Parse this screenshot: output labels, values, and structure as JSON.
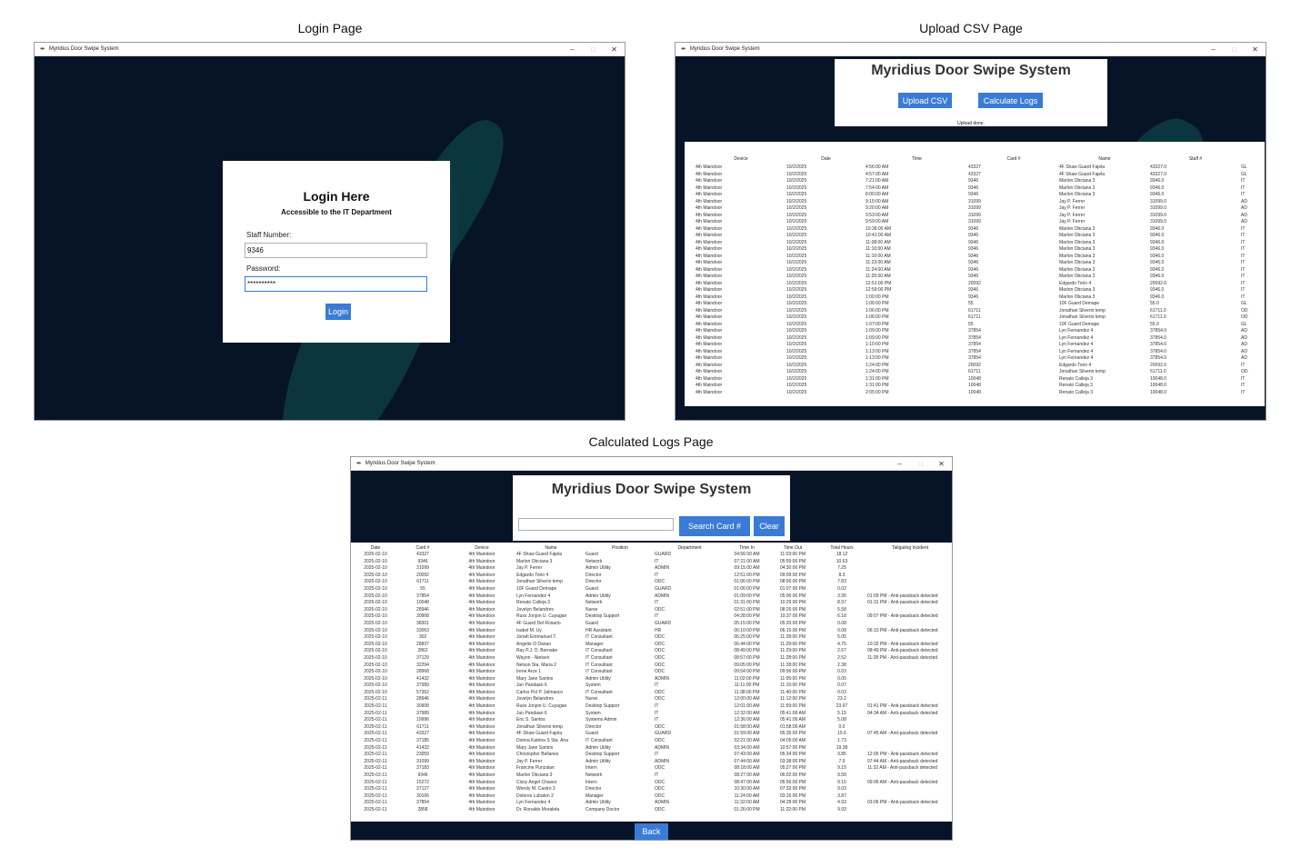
{
  "captions": {
    "login": "Login Page",
    "upload": "Upload CSV Page",
    "calc": "Calculated Logs Page"
  },
  "window": {
    "title": "Myridius Door Swipe System",
    "minimize": "–",
    "maximize": "□",
    "close": "✕"
  },
  "login": {
    "heading": "Login Here",
    "subheading": "Accessible to the IT Department",
    "staff_label": "Staff Number:",
    "staff_value": "9346",
    "password_label": "Password:",
    "password_value": "**********",
    "login_button": "Login"
  },
  "upload": {
    "heading": "Myridius Door Swipe System",
    "upload_button": "Upload CSV",
    "calculate_button": "Calculate Logs",
    "status": "Upload done.",
    "columns": [
      "Device",
      "Date",
      "Time",
      "Card #",
      "Name",
      "Staff #",
      ""
    ],
    "rows": [
      [
        "4th Maindoor",
        "10/2/2025",
        "4:56:00 AM",
        "43327",
        "4F Shaw Guard Fajela",
        "43327.0",
        "GL"
      ],
      [
        "4th Maindoor",
        "10/2/2025",
        "4:57:00 AM",
        "43327",
        "4F Shaw Guard Fajela",
        "43327.0",
        "GL"
      ],
      [
        "4th Maindoor",
        "10/2/2025",
        "7:21:00 AM",
        "9346",
        "Marlon Obciana 3",
        "9346.0",
        "IT"
      ],
      [
        "4th Maindoor",
        "10/2/2025",
        "7:54:00 AM",
        "9346",
        "Marlon Obciana 3",
        "9346.0",
        "IT"
      ],
      [
        "4th Maindoor",
        "10/2/2025",
        "8:00:00 AM",
        "9346",
        "Marlon Obciana 3",
        "9346.0",
        "IT"
      ],
      [
        "4th Maindoor",
        "10/2/2025",
        "9:15:00 AM",
        "31099",
        "Jay P. Ferrer",
        "31099.0",
        "AD"
      ],
      [
        "4th Maindoor",
        "10/2/2025",
        "9:20:00 AM",
        "31099",
        "Jay P. Ferrer",
        "31099.0",
        "AD"
      ],
      [
        "4th Maindoor",
        "10/2/2025",
        "9:53:00 AM",
        "31099",
        "Jay P. Ferrer",
        "31099.0",
        "AD"
      ],
      [
        "4th Maindoor",
        "10/2/2025",
        "9:59:00 AM",
        "31099",
        "Jay P. Ferrer",
        "31099.0",
        "AD"
      ],
      [
        "4th Maindoor",
        "10/2/2025",
        "10:36:00 AM",
        "9346",
        "Marlon Obciana 3",
        "9346.0",
        "IT"
      ],
      [
        "4th Maindoor",
        "10/2/2025",
        "10:41:00 AM",
        "9346",
        "Marlon Obciana 3",
        "9346.0",
        "IT"
      ],
      [
        "4th Maindoor",
        "10/2/2025",
        "11:08:00 AM",
        "9346",
        "Marlon Obciana 3",
        "9346.0",
        "IT"
      ],
      [
        "4th Maindoor",
        "10/2/2025",
        "11:10:00 AM",
        "9346",
        "Marlon Obciana 3",
        "9346.0",
        "IT"
      ],
      [
        "4th Maindoor",
        "10/2/2025",
        "11:10:00 AM",
        "9346",
        "Marlon Obciana 3",
        "9346.0",
        "IT"
      ],
      [
        "4th Maindoor",
        "10/2/2025",
        "11:23:00 AM",
        "9346",
        "Marlon Obciana 3",
        "9346.0",
        "IT"
      ],
      [
        "4th Maindoor",
        "10/2/2025",
        "11:24:00 AM",
        "9346",
        "Marlon Obciana 3",
        "9346.0",
        "IT"
      ],
      [
        "4th Maindoor",
        "10/2/2025",
        "11:25:00 AM",
        "9346",
        "Marlon Obciana 3",
        "9346.0",
        "IT"
      ],
      [
        "4th Maindoor",
        "10/2/2025",
        "12:51:00 PM",
        "20092",
        "Edgardo Torio 4",
        "20092.0",
        "IT"
      ],
      [
        "4th Maindoor",
        "10/2/2025",
        "12:59:00 PM",
        "9346",
        "Marlon Obciana 3",
        "9346.0",
        "IT"
      ],
      [
        "4th Maindoor",
        "10/2/2025",
        "1:00:00 PM",
        "9346",
        "Marlon Obciana 3",
        "9346.0",
        "IT"
      ],
      [
        "4th Maindoor",
        "10/2/2025",
        "1:06:00 PM",
        "55",
        "10F Guard Demape",
        "55.0",
        "GL"
      ],
      [
        "4th Maindoor",
        "10/2/2025",
        "1:06:00 PM",
        "61711",
        "Jonathan Silverio temp",
        "61711.0",
        "OD"
      ],
      [
        "4th Maindoor",
        "10/2/2025",
        "1:06:00 PM",
        "61711",
        "Jonathan Silverio temp",
        "61711.0",
        "OD"
      ],
      [
        "4th Maindoor",
        "10/2/2025",
        "1:07:00 PM",
        "55",
        "10F Guard Demape",
        "55.0",
        "GL"
      ],
      [
        "4th Maindoor",
        "10/2/2025",
        "1:09:00 PM",
        "37854",
        "Lyn Fernandez 4",
        "37854.0",
        "AD"
      ],
      [
        "4th Maindoor",
        "10/2/2025",
        "1:09:00 PM",
        "37854",
        "Lyn Fernandez 4",
        "37854.0",
        "AD"
      ],
      [
        "4th Maindoor",
        "10/2/2025",
        "1:10:00 PM",
        "37854",
        "Lyn Fernandez 4",
        "37854.0",
        "AD"
      ],
      [
        "4th Maindoor",
        "10/2/2025",
        "1:13:00 PM",
        "37854",
        "Lyn Fernandez 4",
        "37854.0",
        "AD"
      ],
      [
        "4th Maindoor",
        "10/2/2025",
        "1:13:00 PM",
        "37854",
        "Lyn Fernandez 4",
        "37854.0",
        "AD"
      ],
      [
        "4th Maindoor",
        "10/2/2025",
        "1:24:00 PM",
        "20092",
        "Edgardo Torio 4",
        "20092.0",
        "IT"
      ],
      [
        "4th Maindoor",
        "10/2/2025",
        "1:24:00 PM",
        "61711",
        "Jonathan Silverio temp",
        "61711.0",
        "OD"
      ],
      [
        "4th Maindoor",
        "10/2/2025",
        "1:31:00 PM",
        "10048",
        "Renato Calleja 3",
        "10048.0",
        "IT"
      ],
      [
        "4th Maindoor",
        "10/2/2025",
        "1:31:00 PM",
        "10048",
        "Renato Calleja 3",
        "10048.0",
        "IT"
      ],
      [
        "4th Maindoor",
        "10/2/2025",
        "2:05:00 PM",
        "10048",
        "Renato Calleja 3",
        "10048.0",
        "IT"
      ]
    ]
  },
  "calc": {
    "heading": "Myridius Door Swipe System",
    "search_value": "",
    "search_button": "Search Card #",
    "clear_button": "Clear",
    "back_button": "Back",
    "columns": [
      "Date",
      "Card #",
      "Device",
      "Name",
      "Position",
      "Department",
      "Time In",
      "Time Out",
      "Total Hours",
      "Tailgating Incident"
    ],
    "rows": [
      [
        "2025-02-10",
        "43327",
        "4th Maindoor",
        "4F Shaw Guard Fajela",
        "Guard",
        "GUARD",
        "04:56:00 AM",
        "11:03:00 PM",
        "18.12",
        ""
      ],
      [
        "2025-02-10",
        "9346",
        "4th Maindoor",
        "Marlon Obciana 3",
        "Network",
        "IT",
        "07:21:00 AM",
        "05:59:00 PM",
        "10.63",
        ""
      ],
      [
        "2025-02-10",
        "31099",
        "4th Maindoor",
        "Jay P. Ferrer",
        "Admin Utility",
        "ADMIN",
        "09:15:00 AM",
        "04:30:00 PM",
        "7.25",
        ""
      ],
      [
        "2025-02-10",
        "20092",
        "4th Maindoor",
        "Edgardo Torio 4",
        "Director",
        "IT",
        "12:51:00 PM",
        "09:09:00 PM",
        "8.3",
        ""
      ],
      [
        "2025-02-10",
        "61711",
        "4th Maindoor",
        "Jonathan Silverio temp",
        "Director",
        "ODC",
        "01:06:00 PM",
        "08:56:00 PM",
        "7.83",
        ""
      ],
      [
        "2025-02-10",
        "55",
        "4th Maindoor",
        "10F Guard Demape",
        "Guard",
        "GUARD",
        "01:06:00 PM",
        "01:07:00 PM",
        "0.02",
        ""
      ],
      [
        "2025-02-10",
        "37854",
        "4th Maindoor",
        "Lyn Fernandez 4",
        "Admin Utility",
        "ADMIN",
        "01:09:00 PM",
        "05:06:00 PM",
        "3.95",
        "01:09 PM - Anti-passback detected"
      ],
      [
        "2025-02-10",
        "10048",
        "4th Maindoor",
        "Renato Calleja 3",
        "Network",
        "IT",
        "01:31:00 PM",
        "10:29:00 PM",
        "8.97",
        "01:31 PM - Anti-passback detected"
      ],
      [
        "2025-02-10",
        "28946",
        "4th Maindoor",
        "Jovelyn Belandres",
        "Nurse",
        "ODC",
        "02:51:00 PM",
        "08:26:00 PM",
        "5.58",
        ""
      ],
      [
        "2025-02-10",
        "30908",
        "4th Maindoor",
        "Russ Jonjon U. Cuyagan",
        "Desktop Support",
        "IT",
        "04:28:00 PM",
        "10:37:00 PM",
        "6.18",
        "09:07 PM - Anti-passback detected"
      ],
      [
        "2025-02-10",
        "38301",
        "4th Maindoor",
        "4F Guard Del Rosario",
        "Guard",
        "GUARD",
        "05:15:00 PM",
        "05:20:00 PM",
        "0.08",
        ""
      ],
      [
        "2025-02-10",
        "33063",
        "4th Maindoor",
        "Isabel M. Uy",
        "HR Assistant",
        "HR",
        "06:10:00 PM",
        "06:15:00 PM",
        "0.08",
        "06:10 PM - Anti-passback detected"
      ],
      [
        "2025-02-10",
        "302",
        "4th Maindoor",
        "Jonah Emmanuel T.",
        "IT Consultant",
        "ODC",
        "06:25:00 PM",
        "11:28:00 PM",
        "5.05",
        ""
      ],
      [
        "2025-02-10",
        "28837",
        "4th Maindoor",
        "Angelie O Danao",
        "Manager",
        "ODC",
        "06:44:00 PM",
        "11:29:00 PM",
        "4.75",
        "10:32 PM - Anti-passback detected"
      ],
      [
        "2025-02-10",
        "2862",
        "4th Maindoor",
        "Ray P.J. O. Bernabe",
        "IT Consultant",
        "ODC",
        "08:49:00 PM",
        "11:29:00 PM",
        "2.67",
        "08:49 PM - Anti-passback detected"
      ],
      [
        "2025-02-10",
        "37129",
        "4th Maindoor",
        "Waynn - Nielsen",
        "IT Consultant",
        "ODC",
        "08:57:00 PM",
        "11:28:00 PM",
        "2.52",
        "11:28 PM - Anti-passback detected"
      ],
      [
        "2025-02-10",
        "32294",
        "4th Maindoor",
        "Nelson Sta. Maria 2",
        "IT Consultant",
        "ODC",
        "09:05:00 PM",
        "11:28:00 PM",
        "2.38",
        ""
      ],
      [
        "2025-02-10",
        "28968",
        "4th Maindoor",
        "Irene Arce 1",
        "IT Consultant",
        "ODC",
        "09:54:00 PM",
        "09:56:00 PM",
        "0.03",
        ""
      ],
      [
        "2025-02-10",
        "41432",
        "4th Maindoor",
        "Mary Jane Santos",
        "Admin Utility",
        "ADMIN",
        "11:02:00 PM",
        "11:05:00 PM",
        "0.05",
        ""
      ],
      [
        "2025-02-10",
        "37989",
        "4th Maindoor",
        "Jun Pandaan 6",
        "System",
        "IT",
        "11:11:00 PM",
        "11:15:00 PM",
        "0.07",
        ""
      ],
      [
        "2025-02-10",
        "57352",
        "4th Maindoor",
        "Carlos Pol P. Jalmasco",
        "IT Consultant",
        "ODC",
        "11:38:00 PM",
        "11:40:00 PM",
        "0.03",
        ""
      ],
      [
        "2025-02-11",
        "28946",
        "4th Maindoor",
        "Jovelyn Belandres",
        "Nurse",
        "ODC",
        "12:00:00 AM",
        "11:12:00 PM",
        "23.2",
        ""
      ],
      [
        "2025-02-11",
        "30908",
        "4th Maindoor",
        "Russ Jonjon U. Cuyagan",
        "Desktop Support",
        "IT",
        "12:01:00 AM",
        "11:59:00 PM",
        "23.97",
        "01:41 PM - Anti-passback detected"
      ],
      [
        "2025-02-11",
        "37989",
        "4th Maindoor",
        "Jun Pandaan 6",
        "System",
        "IT",
        "12:32:00 AM",
        "05:41:00 AM",
        "5.15",
        "04:34 AM - Anti-passback detected"
      ],
      [
        "2025-02-11",
        "19996",
        "4th Maindoor",
        "Eric S. Santos",
        "Systems Admin",
        "IT",
        "12:36:00 AM",
        "05:41:00 AM",
        "5.08",
        ""
      ],
      [
        "2025-02-11",
        "61711",
        "4th Maindoor",
        "Jonathan Silverio temp",
        "Director",
        "ODC",
        "01:58:00 AM",
        "01:58:00 AM",
        "0.0",
        ""
      ],
      [
        "2025-02-11",
        "43327",
        "4th Maindoor",
        "4F Shaw Guard Fajela",
        "Guard",
        "GUARD",
        "01:59:00 AM",
        "05:35:00 PM",
        "15.6",
        "07:45 AM - Anti-passback detected"
      ],
      [
        "2025-02-11",
        "37185",
        "4th Maindoor",
        "Donna Katrina S Sta. Ana",
        "IT Consultant",
        "ODC",
        "02:21:00 AM",
        "04:05:00 AM",
        "1.73",
        ""
      ],
      [
        "2025-02-11",
        "41432",
        "4th Maindoor",
        "Mary Jane Santos",
        "Admin Utility",
        "ADMIN",
        "03:34:00 AM",
        "10:57:00 PM",
        "19.38",
        ""
      ],
      [
        "2025-02-11",
        "23059",
        "4th Maindoor",
        "Christopher Bellanes",
        "Desktop Support",
        "IT",
        "07:43:00 AM",
        "05:34:00 PM",
        "9.85",
        "12:05 PM - Anti-passback detected"
      ],
      [
        "2025-02-11",
        "31099",
        "4th Maindoor",
        "Jay P. Ferrer",
        "Admin Utility",
        "ADMIN",
        "07:44:00 AM",
        "03:38:00 PM",
        "7.9",
        "07:44 AM - Anti-passback detected"
      ],
      [
        "2025-02-11",
        "37183",
        "4th Maindoor",
        "Francine Punzalan",
        "Intern",
        "ODC",
        "08:18:00 AM",
        "05:27:00 PM",
        "9.15",
        "11:32 AM - Anti-passback detected"
      ],
      [
        "2025-02-11",
        "9346",
        "4th Maindoor",
        "Marlon Obciana 3",
        "Network",
        "IT",
        "08:27:00 AM",
        "06:02:00 PM",
        "9.58",
        ""
      ],
      [
        "2025-02-11",
        "15272",
        "4th Maindoor",
        "Cissy Angel Chavez",
        "Intern",
        "ODC",
        "08:47:00 AM",
        "05:56:00 PM",
        "9.15",
        "09:06 AM - Anti-passback detected"
      ],
      [
        "2025-02-11",
        "37127",
        "4th Maindoor",
        "Wendy M. Castro 3",
        "Director",
        "ODC",
        "10:30:00 AM",
        "07:32:00 PM",
        "9.03",
        ""
      ],
      [
        "2025-02-11",
        "30166",
        "4th Maindoor",
        "Dolores Lubaton 2",
        "Manager",
        "ODC",
        "11:24:00 AM",
        "03:16:00 PM",
        "3.87",
        ""
      ],
      [
        "2025-02-11",
        "37854",
        "4th Maindoor",
        "Lyn Fernandez 4",
        "Admin Utility",
        "ADMIN",
        "11:32:00 AM",
        "04:28:00 PM",
        "4.93",
        "03:06 PM - Anti-passback detected"
      ],
      [
        "2025-02-11",
        "2858",
        "4th Maindoor",
        "Dr. Ronaldo Moraleta",
        "Company Doctor",
        "ODC",
        "01:26:00 PM",
        "11:22:00 PM",
        "9.93",
        ""
      ]
    ]
  }
}
